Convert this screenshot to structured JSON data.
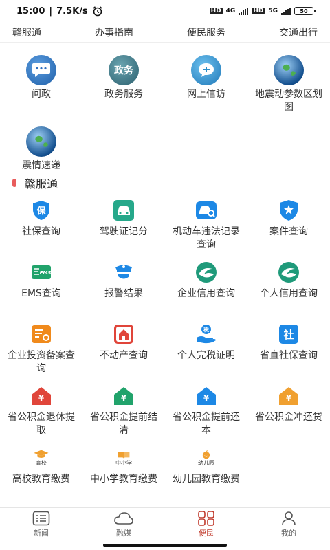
{
  "status_bar": {
    "time": "15:00",
    "speed": "7.5K/s",
    "net_hd_1": "HD",
    "net_type": "4G",
    "net_hd_2": "HD",
    "net_type_2": "5G",
    "battery": "50"
  },
  "top_nav": [
    "赣服通",
    "办事指南",
    "便民服务",
    "交通出行"
  ],
  "featured": [
    {
      "label": "问政",
      "icon": "chat-bubble-icon",
      "color": "#2f6fbf"
    },
    {
      "label": "政务服务",
      "icon": "government-service-icon",
      "color": "#3b7d8c",
      "icon_text": "政务"
    },
    {
      "label": "网上信访",
      "icon": "online-petition-icon",
      "color": "#2d8fc8"
    },
    {
      "label": "地震动参数区划图",
      "icon": "earth-globe-icon",
      "color": "#3a78b8"
    },
    {
      "label": "震情速递",
      "icon": "earth-globe-icon",
      "color": "#3a78b8"
    }
  ],
  "section": {
    "title": "赣服通"
  },
  "services": [
    {
      "label": "社保查询",
      "icon": "shield-bao-icon",
      "color": "#1d88e5",
      "icon_text": "保"
    },
    {
      "label": "驾驶证记分",
      "icon": "car-icon",
      "color": "#26a88a"
    },
    {
      "label": "机动车违法记录查询",
      "icon": "car-search-icon",
      "color": "#1d88e5"
    },
    {
      "label": "案件查询",
      "icon": "police-badge-icon",
      "color": "#1d88e5"
    },
    {
      "label": "EMS查询",
      "icon": "ems-icon",
      "color": "#21a36b",
      "icon_text": "EMS"
    },
    {
      "label": "报警结果",
      "icon": "police-officer-icon",
      "color": "#1d88e5"
    },
    {
      "label": "企业信用查询",
      "icon": "credit-swirl-icon",
      "color": "#1f9a7a"
    },
    {
      "label": "个人信用查询",
      "icon": "credit-swirl-icon",
      "color": "#1f9a7a"
    },
    {
      "label": "企业投资备案查询",
      "icon": "document-seal-icon",
      "color": "#f08a1c"
    },
    {
      "label": "不动产查询",
      "icon": "house-icon",
      "color": "#e0453a"
    },
    {
      "label": "个人完税证明",
      "icon": "tax-hand-icon",
      "color": "#1d88e5",
      "icon_text": "税"
    },
    {
      "label": "省直社保查询",
      "icon": "social-security-icon",
      "color": "#1d88e5",
      "icon_text": "社"
    },
    {
      "label": "省公积金退休提取",
      "icon": "fund-house-icon",
      "color": "#e0453a",
      "icon_text": "¥"
    },
    {
      "label": "省公积金提前结清",
      "icon": "fund-house-icon",
      "color": "#21a36b",
      "icon_text": "¥"
    },
    {
      "label": "省公积金提前还本",
      "icon": "fund-house-icon",
      "color": "#1d88e5",
      "icon_text": "¥"
    },
    {
      "label": "省公积金冲还贷",
      "icon": "fund-house-icon",
      "color": "#f0a030",
      "icon_text": "¥"
    },
    {
      "label": "高校教育缴费",
      "icon": "graduation-cap-icon",
      "color": "#f0a030",
      "icon_text": "高校"
    },
    {
      "label": "中小学教育缴费",
      "icon": "book-icon",
      "color": "#f0a030",
      "icon_text": "中小学"
    },
    {
      "label": "幼儿园教育缴费",
      "icon": "kindergarten-icon",
      "color": "#f0a030",
      "icon_text": "幼儿园"
    }
  ],
  "tabs": [
    {
      "label": "新闻",
      "icon": "news-list-icon",
      "active": false
    },
    {
      "label": "融媒",
      "icon": "cloud-icon",
      "active": false
    },
    {
      "label": "便民",
      "icon": "grid-apps-icon",
      "active": true
    },
    {
      "label": "我的",
      "icon": "person-icon",
      "active": false
    }
  ],
  "colors": {
    "accent": "#c0392b",
    "section_bar": "#e85c5c"
  }
}
